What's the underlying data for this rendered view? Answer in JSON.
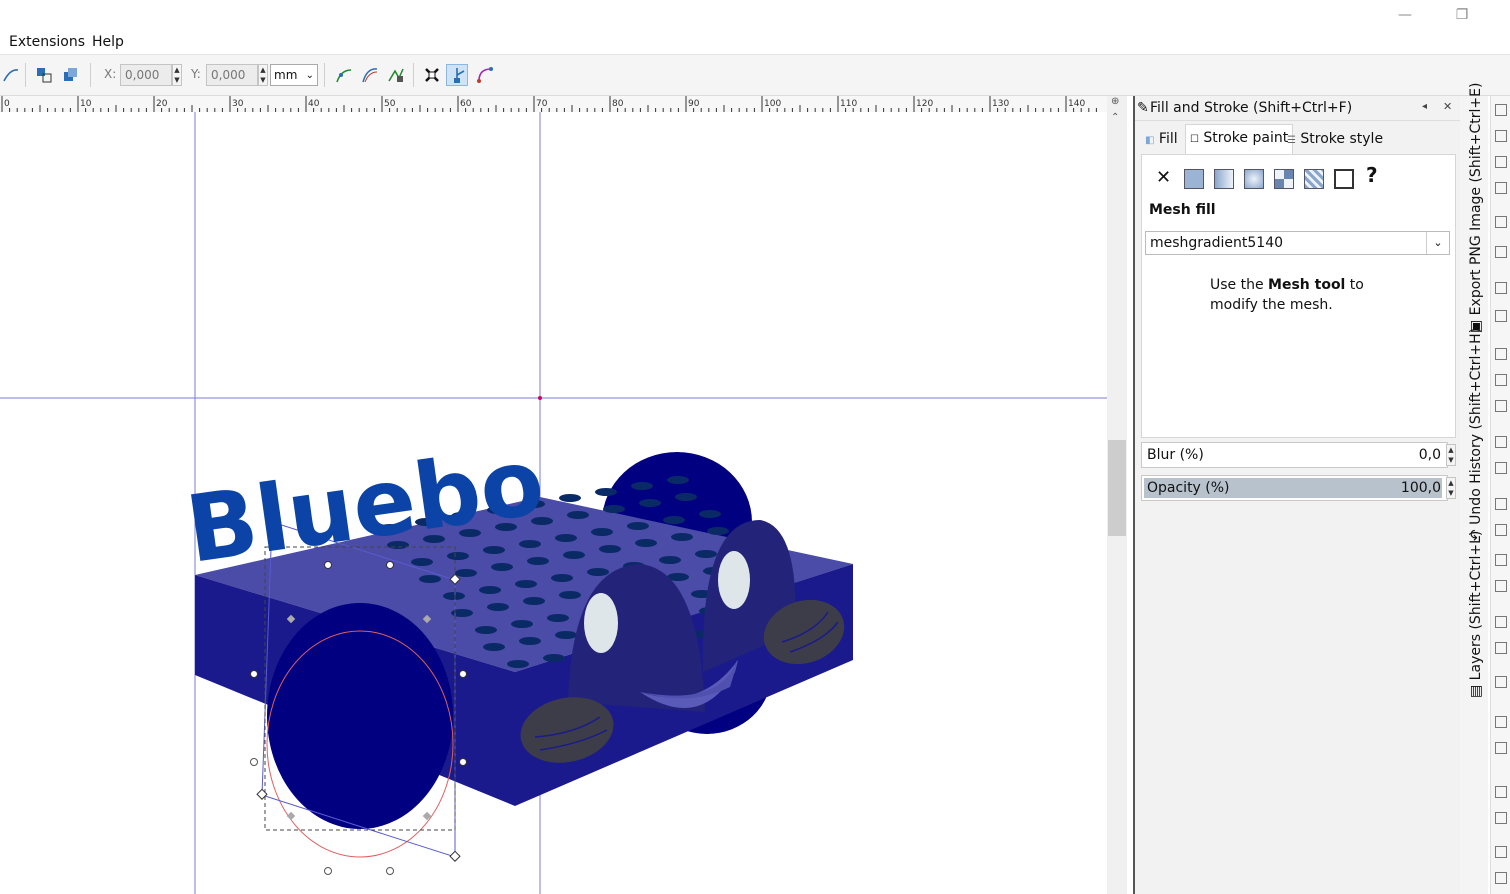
{
  "menubar": {
    "extensions": "Extensions",
    "help": "Help"
  },
  "toolbar": {
    "x_label": "X:",
    "x_value": "0,000",
    "y_label": "Y:",
    "y_value": "0,000",
    "unit": "mm"
  },
  "ruler": {
    "ticks": [
      "0",
      "10",
      "20",
      "30",
      "40",
      "50",
      "60",
      "70",
      "80",
      "90",
      "100",
      "110",
      "120",
      "130",
      "140"
    ]
  },
  "canvas": {
    "logo_text": "Bluebo"
  },
  "panel": {
    "title": "Fill and Stroke (Shift+Ctrl+F)",
    "tabs": {
      "fill": "Fill",
      "stroke_paint": "Stroke paint",
      "stroke_style": "Stroke style"
    },
    "mode_title": "Mesh fill",
    "gradient_name": "meshgradient5140",
    "hint_prefix": "Use the ",
    "hint_bold": "Mesh tool",
    "hint_suffix": " to",
    "hint_line2": "modify the mesh.",
    "unknown_paint": "?",
    "blur_label": "Blur (%)",
    "blur_value": "0,0",
    "opacity_label": "Opacity (%)",
    "opacity_value": "100,0"
  },
  "dock": {
    "export": "Export PNG Image (Shift+Ctrl+E)",
    "undo": "Undo History (Shift+Ctrl+H)",
    "layers": "Layers (Shift+Ctrl+L)"
  },
  "colors": {
    "navy": "#000080",
    "body_dark": "#1a1a8c",
    "body_top": "#4b4ba8",
    "logo_blue": "#0b44a6",
    "guide": "#7b7bd6",
    "panel_bg": "#f2f2f2",
    "opacity_bar": "#b8c2cc"
  }
}
